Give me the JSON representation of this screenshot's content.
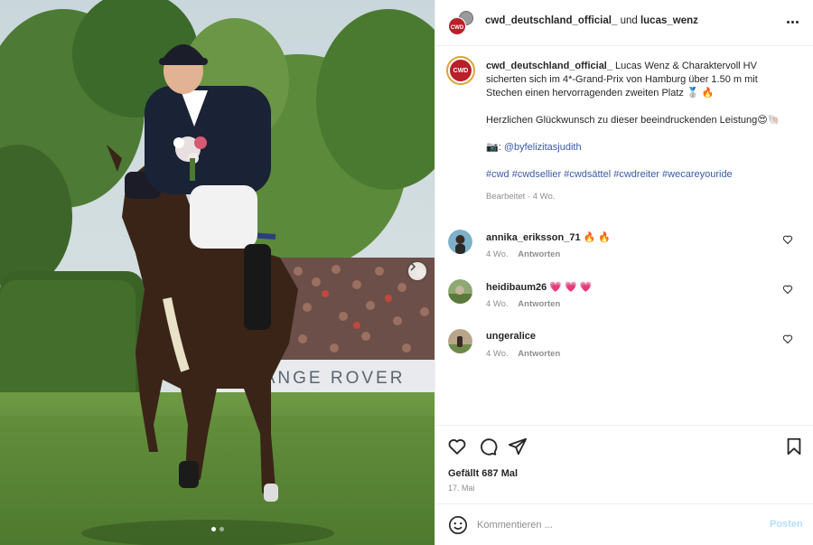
{
  "post": {
    "header": {
      "author": "cwd_deutschland_official_",
      "connector": "und",
      "coauthor": "lucas_wenz"
    },
    "media": {
      "banner_text": "RANGE ROVER",
      "current_slide": 1,
      "total_slides": 2
    },
    "caption": {
      "author": "cwd_deutschland_official_",
      "text": "Lucas Wenz & Charaktervoll HV sicherten sich im 4*-Grand-Prix von Hamburg über 1.50 m mit Stechen einen hervorragenden zweiten Platz 🥈 🔥",
      "congrats": "Herzlichen Glückwunsch zu dieser beeindruckenden Leistung😍🐚",
      "photo_prefix": "📷:",
      "photo_credit": "@byfelizitasjudith",
      "hashtags": "#cwd #cwdsellier #cwdsättel #cwdreiter #wecareyouride",
      "edited": "Bearbeitet · 4 Wo."
    },
    "comments": [
      {
        "user": "annika_eriksson_71",
        "text": "🔥 🔥",
        "age": "4 Wo.",
        "reply": "Antworten"
      },
      {
        "user": "heidibaum26",
        "text": "💗 💗 💗",
        "age": "4 Wo.",
        "reply": "Antworten"
      },
      {
        "user": "ungeralice",
        "text": "",
        "age": "4 Wo.",
        "reply": "Antworten"
      }
    ],
    "likes": "Gefällt 687 Mal",
    "date": "17. Mai",
    "add_comment": {
      "placeholder": "Kommentieren ...",
      "post_label": "Posten"
    }
  },
  "colors": {
    "brand_red": "#b8202a",
    "link_blue": "#3a5ba8",
    "muted_text": "#8e8e8e",
    "post_disabled": "#b2dffc"
  },
  "icons": {
    "like": "heart-icon",
    "comment": "comment-icon",
    "share": "share-icon",
    "save": "bookmark-icon",
    "emoji": "smiley-icon",
    "more": "more-horizontal-icon",
    "next": "chevron-right-icon"
  }
}
